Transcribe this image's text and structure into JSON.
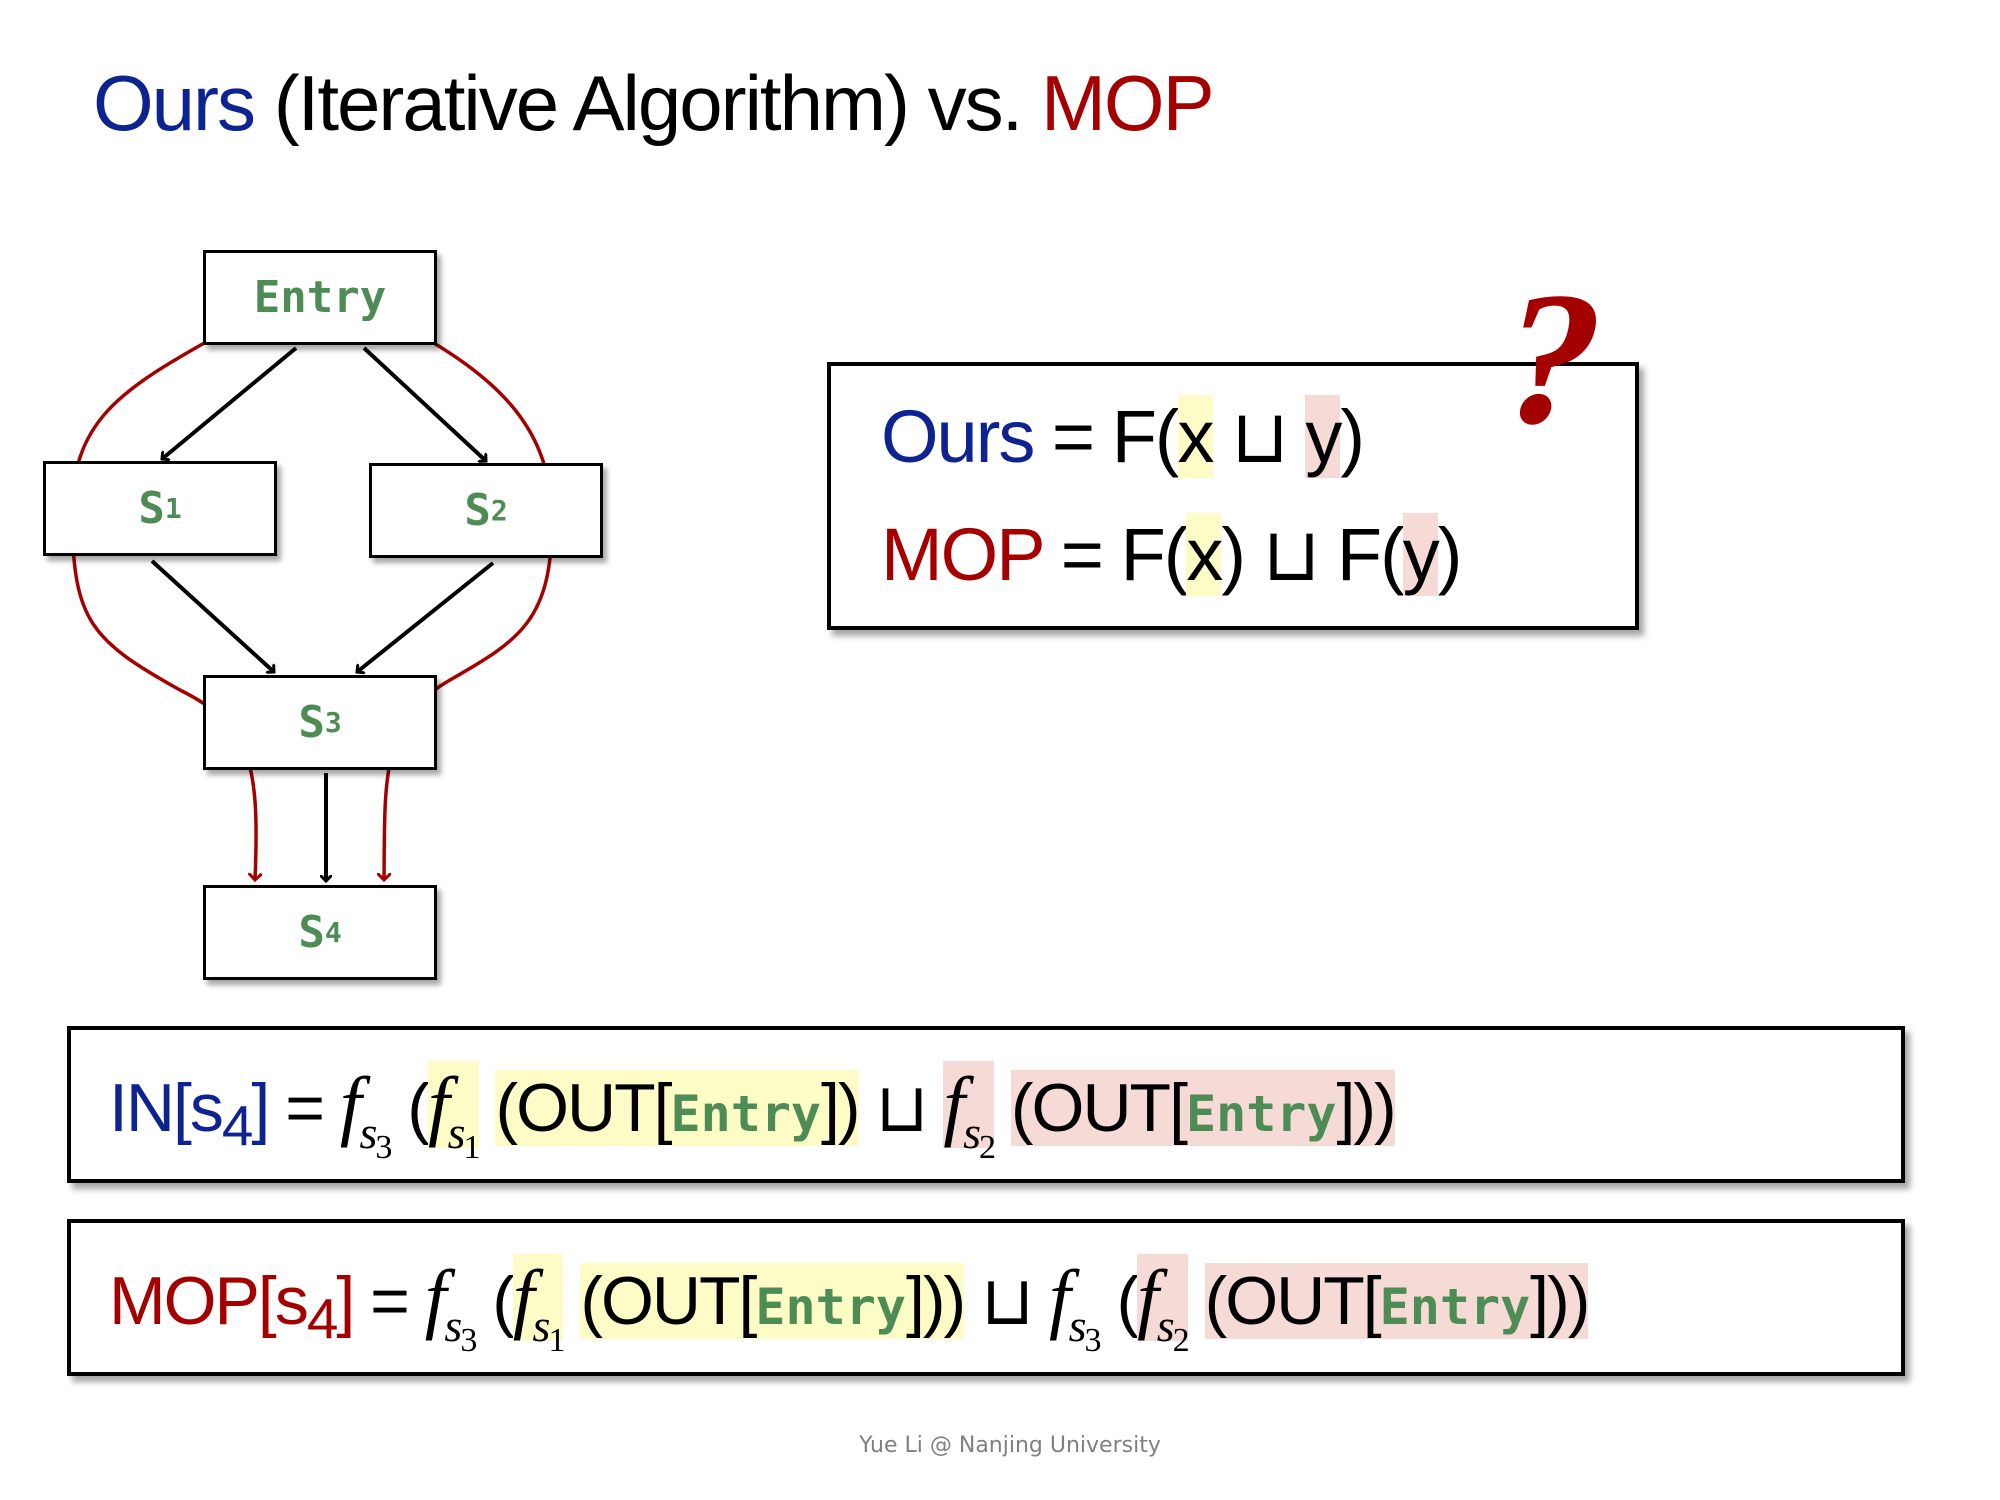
{
  "title": {
    "ours": "Ours",
    "middle": " (Iterative Algorithm) vs. ",
    "mop": "MOP"
  },
  "colors": {
    "ours_blue": "#0d2391",
    "mop_red": "#a50000",
    "node_green": "#4e8c55",
    "highlight_yellow": "#fdfbc6",
    "highlight_pink": "#f6dad6"
  },
  "cfg": {
    "nodes": [
      {
        "id": "entry",
        "label": "Entry",
        "sub": ""
      },
      {
        "id": "s1",
        "label": "S",
        "sub": "1"
      },
      {
        "id": "s2",
        "label": "S",
        "sub": "2"
      },
      {
        "id": "s3",
        "label": "S",
        "sub": "3"
      },
      {
        "id": "s4",
        "label": "S",
        "sub": "4"
      }
    ],
    "edges": [
      {
        "from": "entry",
        "to": "s1",
        "kind": "flow"
      },
      {
        "from": "entry",
        "to": "s2",
        "kind": "flow"
      },
      {
        "from": "s1",
        "to": "s3",
        "kind": "flow"
      },
      {
        "from": "s2",
        "to": "s3",
        "kind": "flow"
      },
      {
        "from": "s3",
        "to": "s4",
        "kind": "flow"
      },
      {
        "from": "entry",
        "to": "s4",
        "via": "s1",
        "kind": "path"
      },
      {
        "from": "entry",
        "to": "s4",
        "via": "s2",
        "kind": "path"
      }
    ]
  },
  "comparison": {
    "ours_label": "Ours",
    "ours_eq": " = F(",
    "x": "x",
    "join": " ⊔ ",
    "y": "y",
    "close": ")",
    "mop_label": "MOP",
    "mop_eq": " = F(",
    "mop_mid": ") ⊔ F(",
    "question": "?"
  },
  "in_formula": {
    "lhs_name": "IN",
    "lhs_open": "[",
    "lhs_node": "s",
    "lhs_sub": "4",
    "lhs_close": "]",
    "eq": " = ",
    "f": "f",
    "s": "s",
    "sub3": "3",
    "sub1": "1",
    "sub2": "2",
    "open": " (",
    "out_open": "(OUT[",
    "entry": "Entry",
    "out_close1": "])",
    "join": " ⊔ ",
    "out_close2": "]))"
  },
  "mop_formula": {
    "lhs_name": "MOP",
    "lhs_open": "[",
    "lhs_node": "s",
    "lhs_sub": "4",
    "lhs_close": "]",
    "eq": " = ",
    "f": "f",
    "s": "s",
    "sub3": "3",
    "sub1": "1",
    "sub2": "2",
    "open": " (",
    "out_open": "(OUT[",
    "entry": "Entry",
    "out_close": "]))",
    "join": " ⊔ "
  },
  "footer": "Yue Li @ Nanjing University"
}
